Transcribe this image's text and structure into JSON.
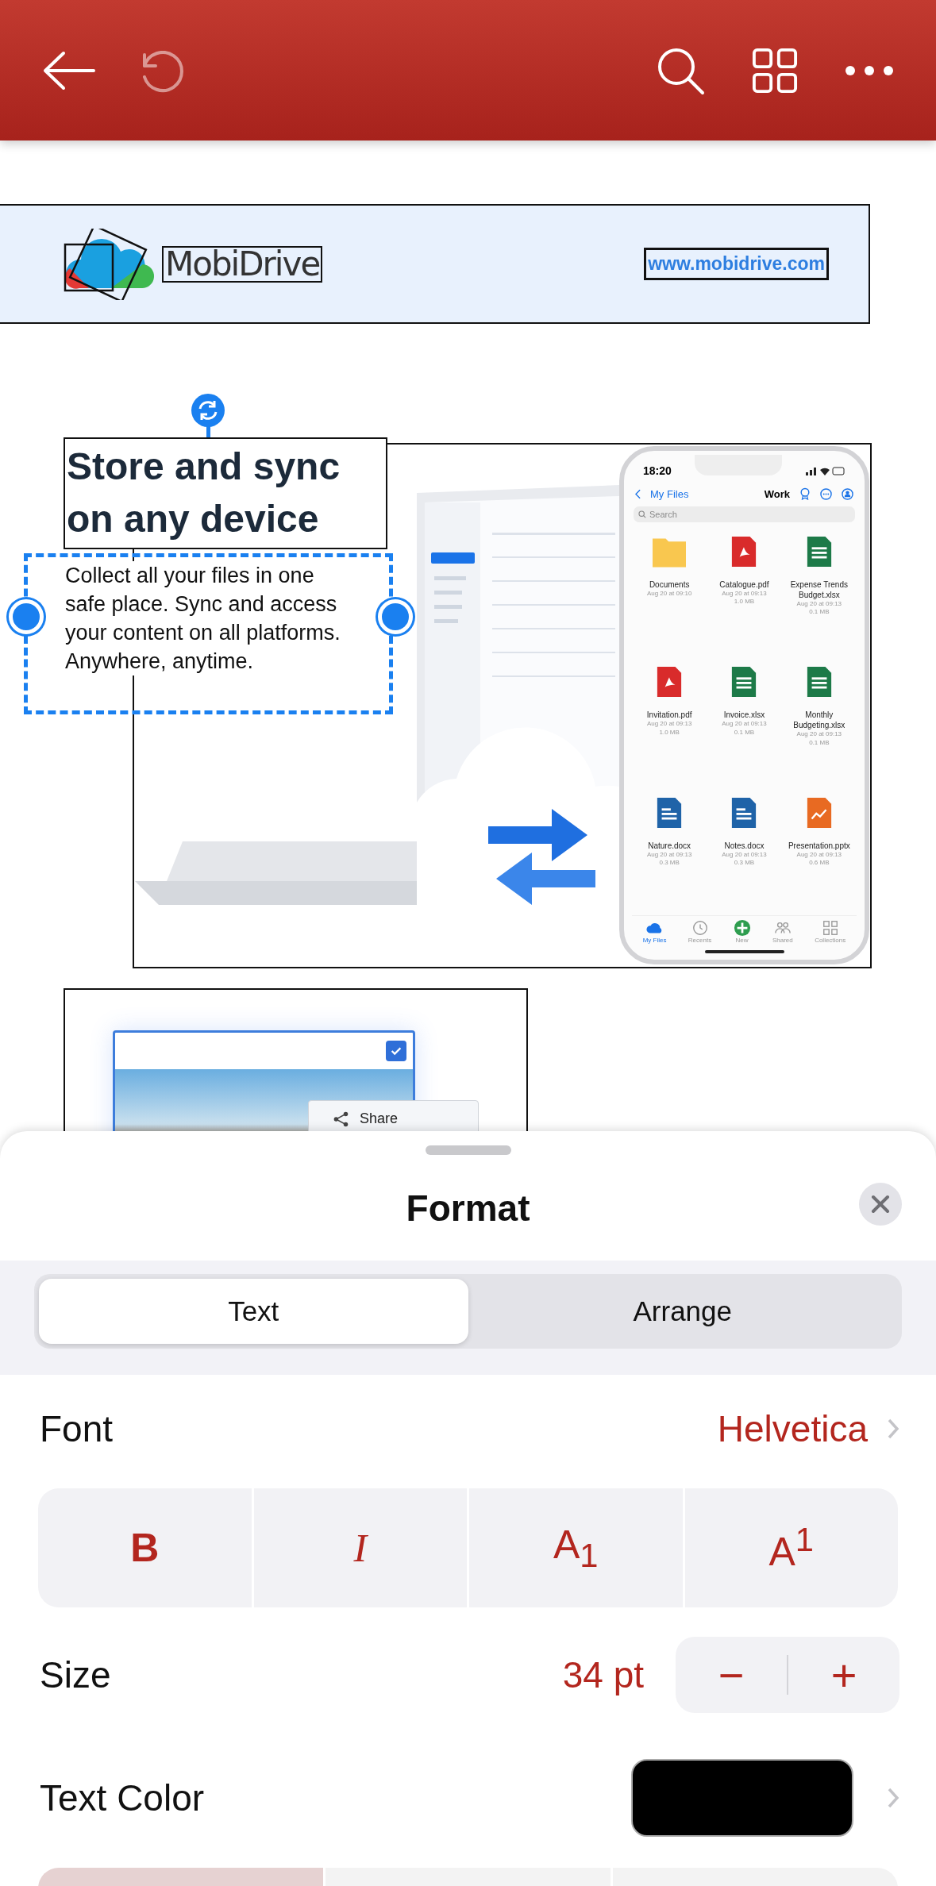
{
  "toolbar": {
    "undo_disabled": true
  },
  "document": {
    "banner": {
      "logo_text": "MobiDrive",
      "url": "www.mobidrive.com"
    },
    "heading": "Store and sync on any device",
    "body": "Collect all your files in one safe place. Sync and access your content on all platforms. Anywhere, anytime.",
    "phone": {
      "time": "18:20",
      "back": "My Files",
      "title": "Work",
      "search_placeholder": "Search",
      "files": [
        {
          "name": "Documents",
          "date": "Aug 20 at 09:10",
          "kind": "folder"
        },
        {
          "name": "Catalogue.pdf",
          "date": "Aug 20 at 09:13",
          "size": "1.0 MB",
          "kind": "pdf"
        },
        {
          "name": "Expense Trends Budget.xlsx",
          "date": "Aug 20 at 09:13",
          "size": "0.1 MB",
          "kind": "xlsx"
        },
        {
          "name": "Invitation.pdf",
          "date": "Aug 20 at 09:13",
          "size": "1.0 MB",
          "kind": "pdf"
        },
        {
          "name": "Invoice.xlsx",
          "date": "Aug 20 at 09:13",
          "size": "0.1 MB",
          "kind": "xlsx"
        },
        {
          "name": "Monthly Budgeting.xlsx",
          "date": "Aug 20 at 09:13",
          "size": "0.1 MB",
          "kind": "xlsx"
        },
        {
          "name": "Nature.docx",
          "date": "Aug 20 at 09:13",
          "size": "0.3 MB",
          "kind": "docx"
        },
        {
          "name": "Notes.docx",
          "date": "Aug 20 at 09:13",
          "size": "0.3 MB",
          "kind": "docx"
        },
        {
          "name": "Presentation.pptx",
          "date": "Aug 20 at 09:13",
          "size": "0.6 MB",
          "kind": "pptx"
        }
      ],
      "tabs": [
        {
          "label": "My Files",
          "selected": true,
          "kind": "files"
        },
        {
          "label": "Recents",
          "selected": false,
          "kind": "recents"
        },
        {
          "label": "New",
          "selected": false,
          "kind": "new"
        },
        {
          "label": "Shared",
          "selected": false,
          "kind": "shared"
        },
        {
          "label": "Collections",
          "selected": false,
          "kind": "collections"
        }
      ]
    },
    "image_card": {
      "checked": true,
      "menu_item": "Share"
    }
  },
  "format_panel": {
    "title": "Format",
    "tabs": [
      {
        "label": "Text",
        "selected": true
      },
      {
        "label": "Arrange",
        "selected": false
      }
    ],
    "font": {
      "label": "Font",
      "value": "Helvetica"
    },
    "styles": [
      {
        "label": "B",
        "kind": "bold"
      },
      {
        "label": "I",
        "kind": "italic"
      },
      {
        "label": "A$_{1}$",
        "kind": "subscript"
      },
      {
        "label": "A$^{1}$",
        "kind": "superscript"
      }
    ],
    "size": {
      "label": "Size",
      "value": "34 pt",
      "decrease": "−",
      "increase": "+"
    },
    "text_color": {
      "label": "Text Color",
      "color": "#000000"
    },
    "partial_row": [
      {
        "selected": true
      },
      {
        "selected": false
      },
      {
        "selected": false
      }
    ]
  }
}
